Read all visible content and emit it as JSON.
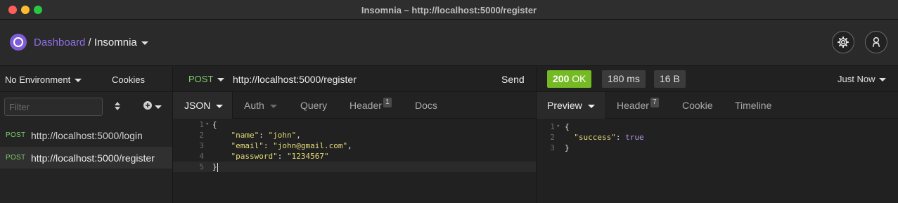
{
  "window": {
    "title": "Insomnia – http://localhost:5000/register"
  },
  "header": {
    "dashboard_label": "Dashboard",
    "separator": " / ",
    "workspace_label": "Insomnia",
    "settings_icon": "gear-icon",
    "account_icon": "user-icon"
  },
  "sidebar": {
    "environment_label": "No Environment",
    "cookies_label": "Cookies",
    "filter_placeholder": "Filter",
    "requests": [
      {
        "method": "POST",
        "url": "http://localhost:5000/login",
        "active": false
      },
      {
        "method": "POST",
        "url": "http://localhost:5000/register",
        "active": true
      }
    ]
  },
  "request": {
    "method": "POST",
    "url": "http://localhost:5000/register",
    "send_label": "Send",
    "tabs": [
      {
        "label": "JSON",
        "active": true
      },
      {
        "label": "Auth",
        "active": false
      },
      {
        "label": "Query",
        "active": false
      },
      {
        "label": "Header",
        "badge": "1",
        "active": false
      },
      {
        "label": "Docs",
        "active": false
      }
    ],
    "body_lines": [
      {
        "num": "1",
        "text": "{"
      },
      {
        "num": "2",
        "key": "\"name\"",
        "value": "\"john\"",
        "trail": ","
      },
      {
        "num": "3",
        "key": "\"email\"",
        "value": "\"john@gmail.com\"",
        "trail": ","
      },
      {
        "num": "4",
        "key": "\"password\"",
        "value": "\"1234567\"",
        "trail": ""
      },
      {
        "num": "5",
        "text": "}"
      }
    ]
  },
  "response": {
    "status_code": "200",
    "status_text": "OK",
    "status_color": "#75ba24",
    "time": "180 ms",
    "size": "16 B",
    "history_label": "Just Now",
    "tabs": [
      {
        "label": "Preview",
        "active": true
      },
      {
        "label": "Header",
        "badge": "7",
        "active": false
      },
      {
        "label": "Cookie",
        "active": false
      },
      {
        "label": "Timeline",
        "active": false
      }
    ],
    "body_lines": [
      {
        "num": "1",
        "text": "{"
      },
      {
        "num": "2",
        "key": "\"success\"",
        "value": "true"
      },
      {
        "num": "3",
        "text": "}"
      }
    ]
  }
}
